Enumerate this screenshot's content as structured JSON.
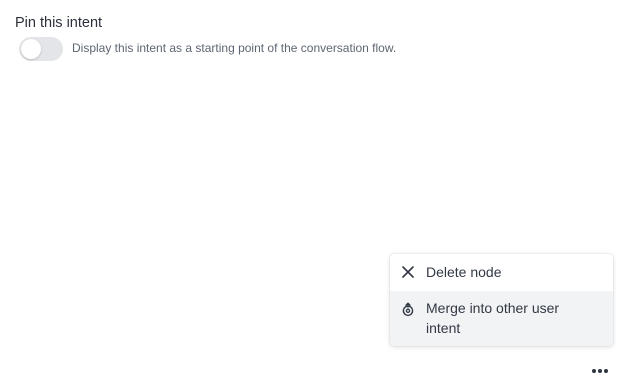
{
  "pin_intent": {
    "title": "Pin this intent",
    "description": "Display this intent as a starting point of the conversation flow.",
    "toggle_on": false
  },
  "context_menu": {
    "items": [
      {
        "label": "Delete node",
        "icon": "close-icon"
      },
      {
        "label": "Merge into other user intent",
        "icon": "merge-icon"
      }
    ]
  },
  "more_button": {
    "icon": "more-horizontal-icon"
  },
  "colors": {
    "toggle_off": "#e3e5e8",
    "menu_hover": "#f2f3f5",
    "text": "#2d3340"
  }
}
